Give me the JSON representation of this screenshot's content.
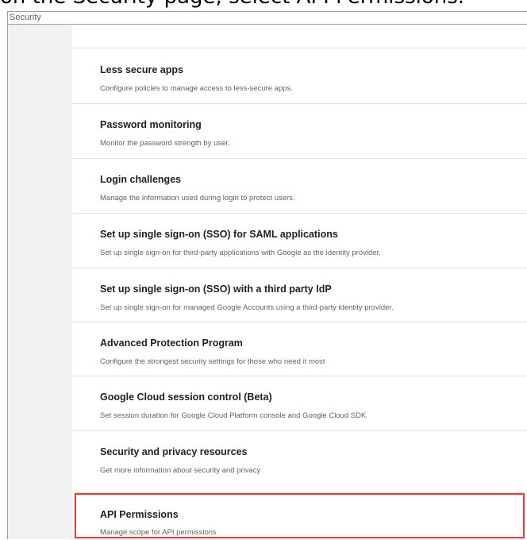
{
  "caption": "on the Security page, select API Permissions.",
  "window": {
    "title": "Security"
  },
  "settings": [
    {
      "title": "Less secure apps",
      "description": "Configure policies to manage access to less-secure apps."
    },
    {
      "title": "Password monitoring",
      "description": "Monitor the password strength by user."
    },
    {
      "title": "Login challenges",
      "description": "Manage the information used during login to protect users."
    },
    {
      "title": "Set up single sign-on (SSO) for SAML applications",
      "description": "Set up single sign-on for third-party applications with Google as the identity provider."
    },
    {
      "title": "Set up single sign-on (SSO) with a third party IdP",
      "description": "Set up single sign-on for managed Google Accounts using a third-party identity provider."
    },
    {
      "title": "Advanced Protection Program",
      "description": "Configure the strongest security settings for those who need it most"
    },
    {
      "title": "Google Cloud session control (Beta)",
      "description": "Set session duration for Google Cloud Platform console and Google Cloud SDK"
    },
    {
      "title": "Security and privacy resources",
      "description": "Get more information about security and privacy"
    },
    {
      "title": "API Permissions",
      "description": "Manage scope for API permissions"
    }
  ],
  "highlight_color": "#e53935"
}
